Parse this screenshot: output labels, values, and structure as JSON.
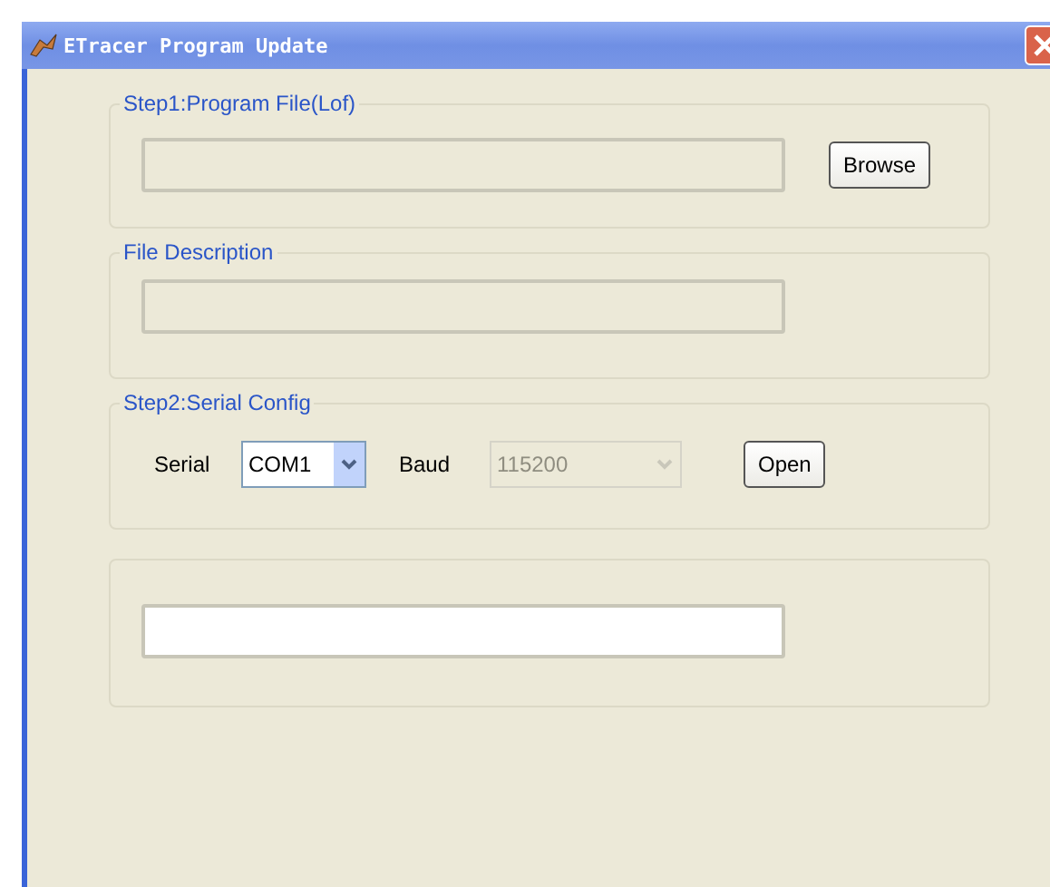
{
  "window": {
    "title": "ETracer Program Update"
  },
  "program_file": {
    "legend": "Step1:Program File(Lof)",
    "field": {
      "disabled": true
    },
    "button": "Browse"
  },
  "file_description": {
    "legend": "File Description",
    "field": {
      "disabled": true
    }
  },
  "serial_config": {
    "legend": "Step2:Serial Config",
    "serial": {
      "label": "Serial",
      "value": "COM1",
      "disabled": false
    },
    "baud": {
      "label": "Baud",
      "value": "115200",
      "disabled": true
    },
    "button": "Open"
  },
  "status": {
    "field": {
      "disabled": false
    }
  }
}
